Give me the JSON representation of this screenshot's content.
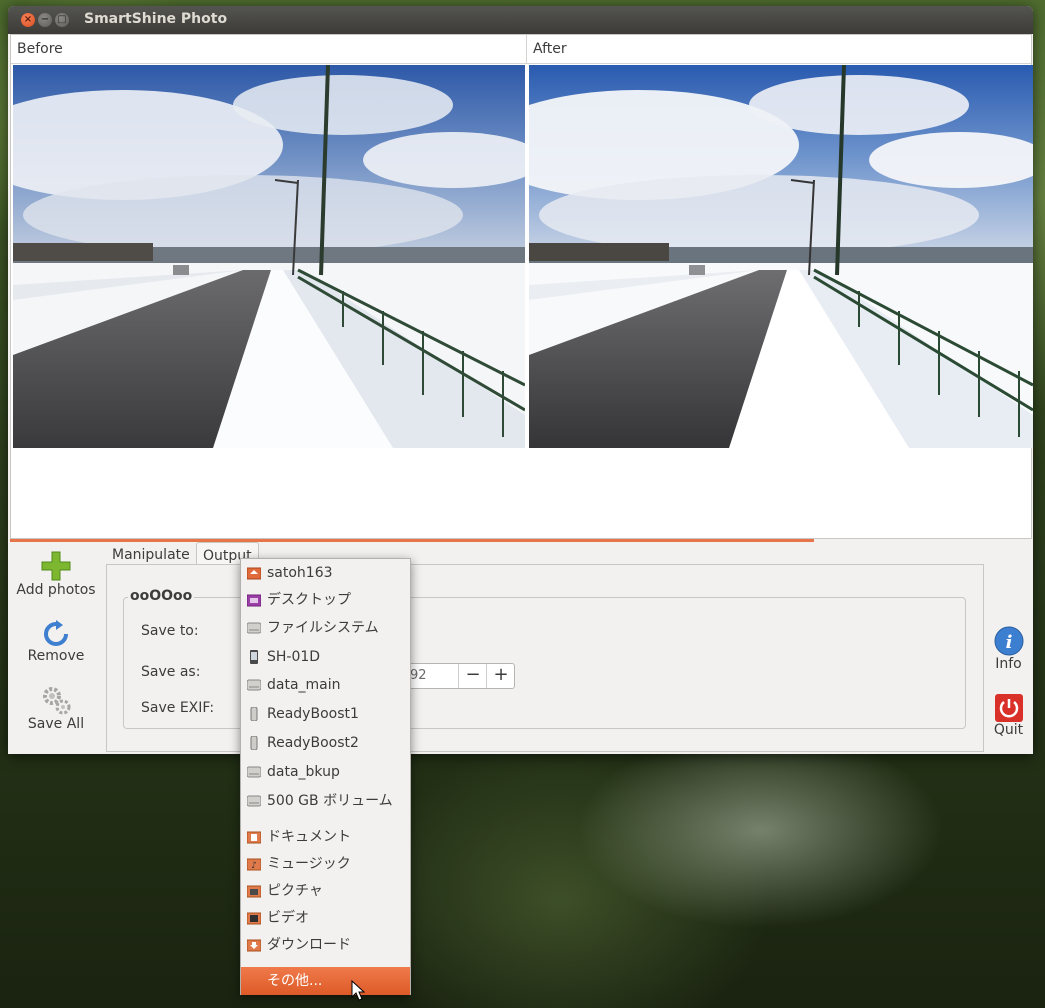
{
  "window": {
    "title": "SmartShine Photo",
    "controls": [
      "close",
      "minimize",
      "maximize"
    ]
  },
  "preview": {
    "before_label": "Before",
    "after_label": "After"
  },
  "toolbar_left": {
    "add_photos": "Add photos",
    "remove": "Remove",
    "save_all": "Save All"
  },
  "toolbar_right": {
    "info": "Info",
    "quit": "Quit"
  },
  "tabs": {
    "manipulate": "Manipulate",
    "output": "Output"
  },
  "output_panel": {
    "frame_title": "ooOOoo",
    "save_to_label": "Save to:",
    "save_as_label": "Save as:",
    "save_exif_label": "Save EXIF:",
    "quality_value": "92",
    "minus": "−",
    "plus": "+"
  },
  "folder_menu": {
    "items": [
      {
        "label": "satoh163",
        "icon": "home-folder-icon"
      },
      {
        "label": "デスクトップ",
        "icon": "desktop-icon"
      },
      {
        "label": "ファイルシステム",
        "icon": "drive-icon"
      },
      {
        "label": "SH-01D",
        "icon": "phone-icon"
      },
      {
        "label": "data_main",
        "icon": "drive-icon"
      },
      {
        "label": "ReadyBoost1",
        "icon": "usb-drive-icon"
      },
      {
        "label": "ReadyBoost2",
        "icon": "usb-drive-icon"
      },
      {
        "label": "data_bkup",
        "icon": "drive-icon"
      },
      {
        "label": "500 GB ボリューム",
        "icon": "drive-icon"
      },
      {
        "label": "ドキュメント",
        "icon": "documents-folder-icon"
      },
      {
        "label": "ミュージック",
        "icon": "music-folder-icon"
      },
      {
        "label": "ピクチャ",
        "icon": "pictures-folder-icon"
      },
      {
        "label": "ビデオ",
        "icon": "videos-folder-icon"
      },
      {
        "label": "ダウンロード",
        "icon": "downloads-folder-icon"
      }
    ],
    "other": "その他..."
  },
  "colors": {
    "accent": "#dd5a27",
    "titlebar": "#3c3b37",
    "window_bg": "#f2f1f0"
  }
}
